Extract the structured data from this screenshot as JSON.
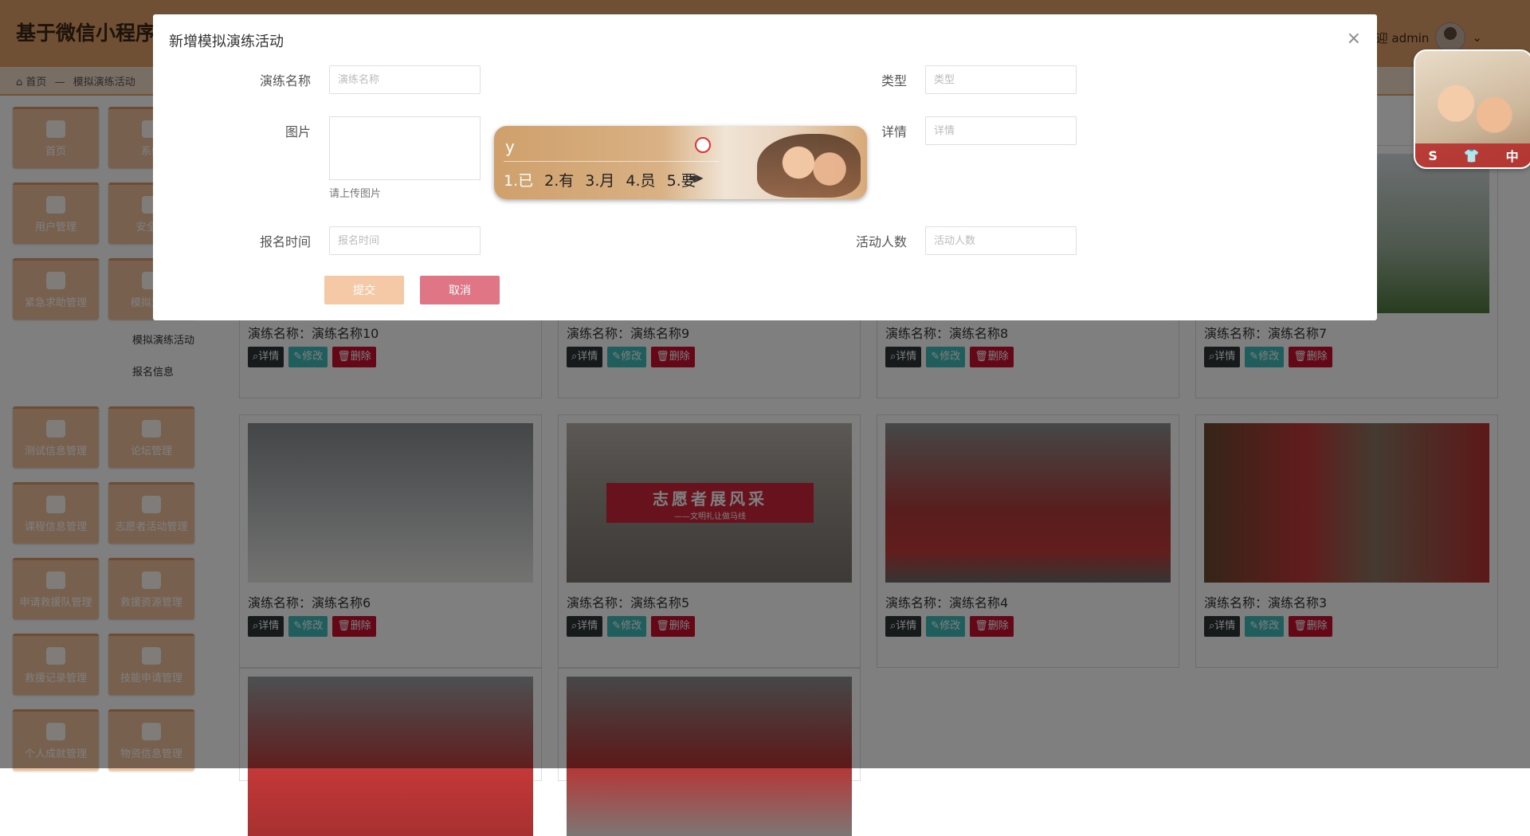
{
  "header": {
    "app_title": "基于微信小程序的",
    "welcome": "欢迎 admin",
    "chevron": "⌄"
  },
  "breadcrumb": {
    "home": "首页",
    "sep": "—",
    "current": "模拟演练活动"
  },
  "sidebar": {
    "items": [
      {
        "label": "首页"
      },
      {
        "label": "系统"
      },
      {
        "label": "用户管理"
      },
      {
        "label": "安全知"
      },
      {
        "label": "紧急求助管理"
      },
      {
        "label": "模拟演练"
      },
      {
        "label": "测试信息管理"
      },
      {
        "label": "论坛管理"
      },
      {
        "label": "课程信息管理"
      },
      {
        "label": "志愿者活动管理"
      },
      {
        "label": "申请救援队管理"
      },
      {
        "label": "救援资源管理"
      },
      {
        "label": "救援记录管理"
      },
      {
        "label": "技能申请管理"
      },
      {
        "label": "个人成就管理"
      },
      {
        "label": "物资信息管理"
      }
    ],
    "submenu": [
      "模拟演练活动",
      "报名信息"
    ]
  },
  "cards": [
    {
      "name": "演练名称：演练名称10"
    },
    {
      "name": "演练名称：演练名称9"
    },
    {
      "name": "演练名称：演练名称8"
    },
    {
      "name": "演练名称：演练名称7"
    },
    {
      "name": "演练名称：演练名称6"
    },
    {
      "name": "演练名称：演练名称5"
    },
    {
      "name": "演练名称：演练名称4"
    },
    {
      "name": "演练名称：演练名称3"
    }
  ],
  "card_buttons": {
    "detail": "详情",
    "edit": "修改",
    "delete": "删除"
  },
  "banner_text": "志愿者展风采",
  "banner_sub": "——文明礼让做马线",
  "modal": {
    "title": "新增模拟演练活动",
    "close": "×",
    "fields": {
      "name_label": "演练名称",
      "name_placeholder": "演练名称",
      "type_label": "类型",
      "type_placeholder": "类型",
      "image_label": "图片",
      "image_hint": "请上传图片",
      "detail_label": "详情",
      "detail_placeholder": "详情",
      "signup_label": "报名时间",
      "signup_placeholder": "报名时间",
      "people_label": "活动人数",
      "people_placeholder": "活动人数"
    },
    "submit": "提交",
    "cancel": "取消"
  },
  "ime": {
    "input": "y",
    "candidates": [
      "1.已",
      "2.有",
      "3.月",
      "4.员",
      "5.要"
    ],
    "arrows": "◀▶"
  },
  "skin_bar": [
    "S",
    "👕",
    "中"
  ],
  "colors": {
    "accent": "#e1a06a",
    "detail": "#2d3436",
    "edit": "#3fbcb8",
    "delete": "#c8102e",
    "submit": "#f5c9a6",
    "cancel": "#e07585"
  }
}
